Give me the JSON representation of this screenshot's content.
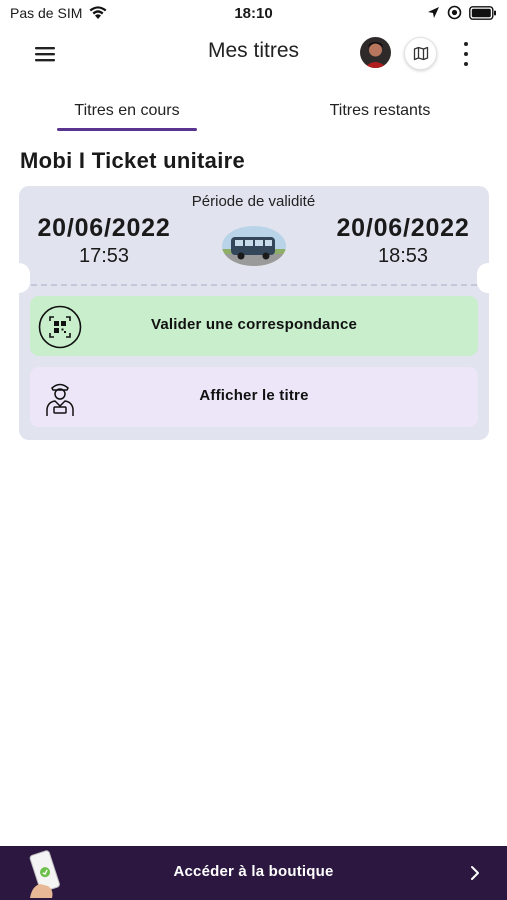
{
  "status_bar": {
    "carrier": "Pas de SIM",
    "time": "18:10"
  },
  "header": {
    "title": "Mes titres",
    "icons": [
      "menu-icon",
      "avatar",
      "map-icon",
      "more-vertical-icon"
    ]
  },
  "tabs": [
    {
      "label": "Titres en cours",
      "active": true
    },
    {
      "label": "Titres restants",
      "active": false
    }
  ],
  "ticket": {
    "title": "Mobi I Ticket unitaire",
    "validity_label": "Période de validité",
    "start_date": "20/06/2022",
    "start_time": "17:53",
    "end_date": "20/06/2022",
    "end_time": "18:53",
    "validate_label": "Valider une correspondance",
    "display_label": "Afficher le titre"
  },
  "shop": {
    "label": "Accéder à la boutique"
  },
  "colors": {
    "accent": "#5a3590",
    "card_bg": "#e1e3ef",
    "validate_bg": "#c8eecc",
    "display_bg": "#ece6f8",
    "shop_bar_bg": "#2c1740"
  }
}
